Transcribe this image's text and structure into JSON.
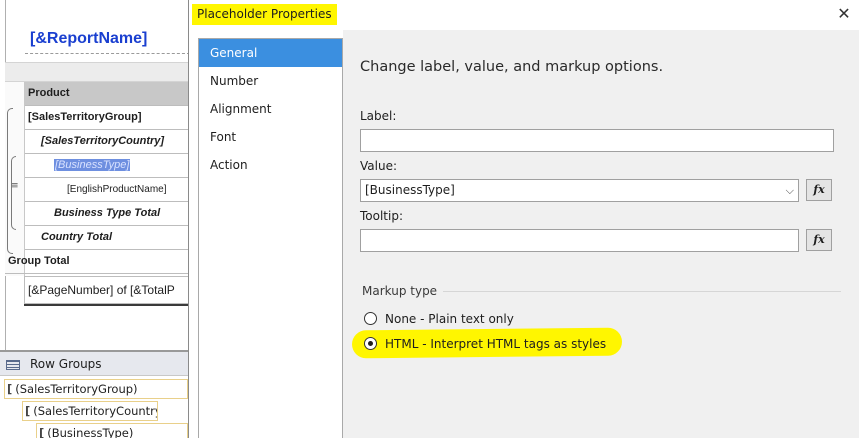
{
  "designer": {
    "report_title": "[&ReportName]",
    "table_rows": [
      {
        "text": "Product"
      },
      {
        "text": "[SalesTerritoryGroup]"
      },
      {
        "text": "[SalesTerritoryCountry]"
      },
      {
        "text": "[BusinessType]"
      },
      {
        "text": "[EnglishProductName]"
      },
      {
        "text": "Business Type Total"
      },
      {
        "text": "Country Total"
      },
      {
        "text": "Group Total"
      }
    ],
    "footer_text": "[&PageNumber] of [&TotalP",
    "row_groups_title": "Row Groups",
    "row_groups": [
      "(SalesTerritoryGroup)",
      "(SalesTerritoryCountry)",
      "(BusinessType)"
    ]
  },
  "dialog": {
    "title": "Placeholder Properties",
    "close_icon": "close-icon",
    "nav": [
      "General",
      "Number",
      "Alignment",
      "Font",
      "Action"
    ],
    "active_nav": "General",
    "heading": "Change label, value, and markup options.",
    "label_label": "Label:",
    "label_value": "",
    "value_label": "Value:",
    "value_value": "[BusinessType]",
    "tooltip_label": "Tooltip:",
    "tooltip_value": "",
    "fx_label": "fx",
    "markup_type_label": "Markup type",
    "markup_options": [
      {
        "label": "None - Plain text only",
        "checked": false
      },
      {
        "label": "HTML - Interpret HTML tags as styles",
        "checked": true
      }
    ],
    "highlight_color": "#fff600",
    "active_nav_color": "#3b8fe0"
  }
}
